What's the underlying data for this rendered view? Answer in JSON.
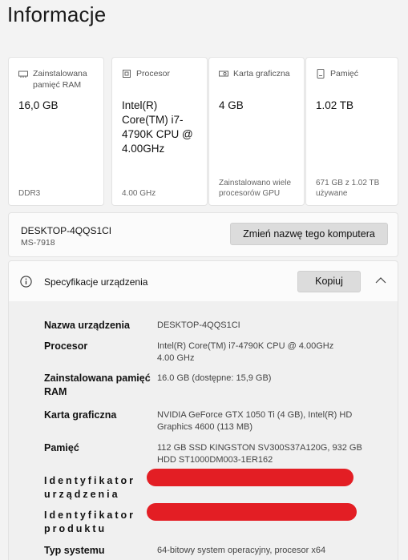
{
  "page": {
    "title": "Informacje"
  },
  "cards": [
    {
      "label": "Zainstalowana pamięć RAM",
      "value": "16,0 GB",
      "footer": "DDR3",
      "icon": "ram-icon"
    },
    {
      "label": "Procesor",
      "value": "Intel(R) Core(TM) i7-4790K CPU @ 4.00GHz",
      "footer": "4.00 GHz",
      "icon": "cpu-icon"
    },
    {
      "label": "Karta graficzna",
      "value": "4 GB",
      "footer": "Zainstalowano wiele procesorów GPU",
      "icon": "gpu-icon"
    },
    {
      "label": "Pamięć",
      "value": "1.02 TB",
      "footer": "671 GB z 1.02 TB używane",
      "icon": "storage-icon"
    }
  ],
  "pc": {
    "name": "DESKTOP-4QQS1CI",
    "model": "MS-7918",
    "rename_label": "Zmień nazwę tego komputera"
  },
  "specs": {
    "title": "Specyfikacje urządzenia",
    "copy_label": "Kopiuj",
    "rows": [
      {
        "key": "Nazwa urządzenia",
        "value": "DESKTOP-4QQS1CI"
      },
      {
        "key": "Procesor",
        "value": "Intel(R) Core(TM) i7-4790K CPU @ 4.00GHz 4.00 GHz"
      },
      {
        "key": "Zainstalowana pamięć RAM",
        "value": "16.0 GB (dostępne: 15,9 GB)"
      },
      {
        "key": "Karta graficzna",
        "value": "NVIDIA GeForce GTX 1050 Ti (4 GB), Intel(R) HD Graphics 4600 (113 MB)"
      },
      {
        "key": "Pamięć",
        "value": "112 GB SSD KINGSTON SV300S37A120G, 932 GB HDD ST1000DM003-1ER162"
      },
      {
        "key": "Identyfikator urządzenia",
        "value": ""
      },
      {
        "key": "Identyfikator produktu",
        "value": ""
      },
      {
        "key": "Typ systemu",
        "value": "64-bitowy system operacyjny, procesor x64"
      }
    ]
  },
  "colors": {
    "redaction": "#e31e24",
    "card_bg": "#ffffff",
    "page_bg": "#f3f3f3"
  }
}
